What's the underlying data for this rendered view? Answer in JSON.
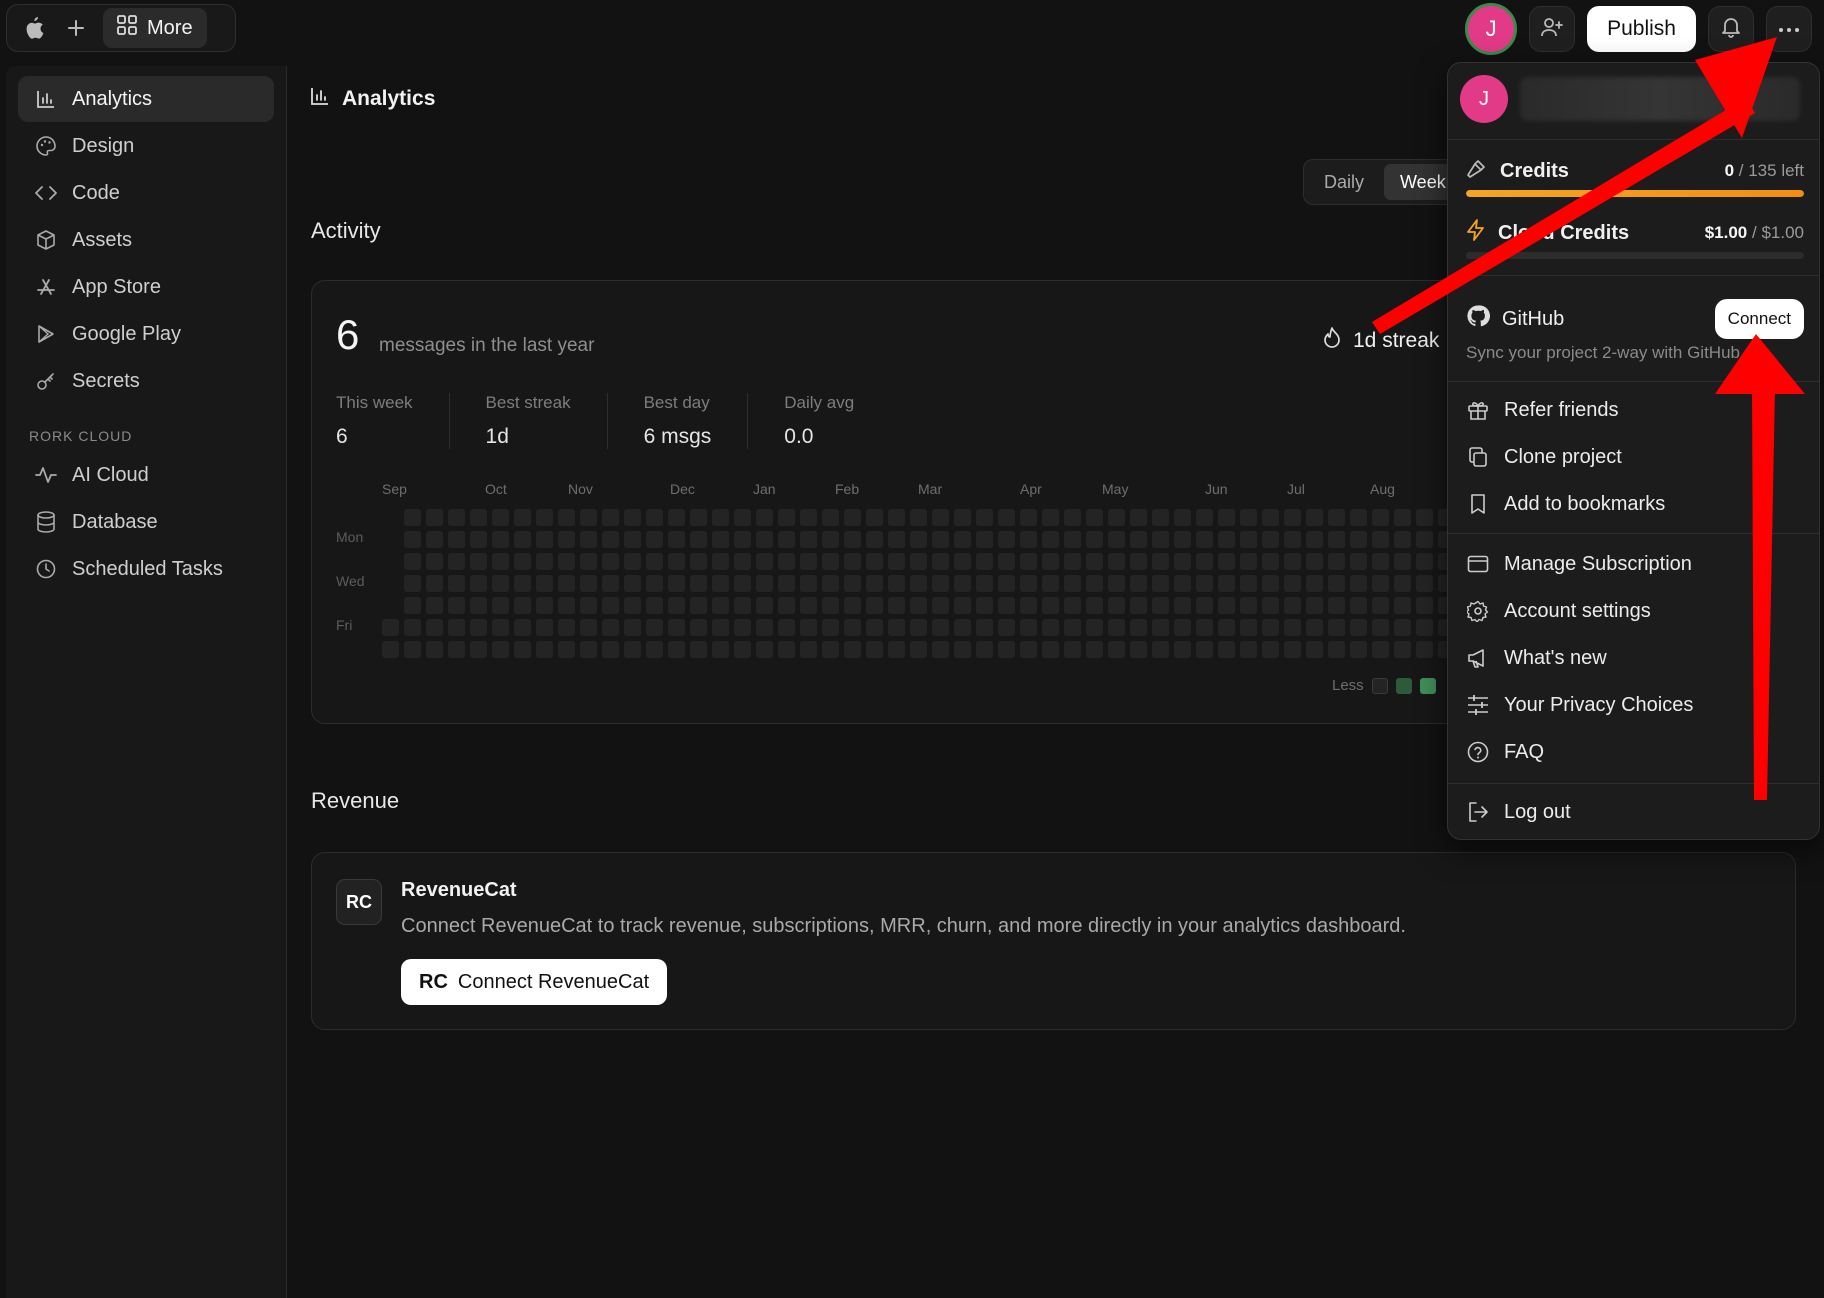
{
  "topbar": {
    "more_label": "More",
    "publish_label": "Publish",
    "avatar_initial": "J"
  },
  "sidebar": {
    "items": [
      {
        "label": "Analytics",
        "icon": "bar-chart-icon"
      },
      {
        "label": "Design",
        "icon": "palette-icon"
      },
      {
        "label": "Code",
        "icon": "code-icon"
      },
      {
        "label": "Assets",
        "icon": "box-icon"
      },
      {
        "label": "App Store",
        "icon": "app-store-icon"
      },
      {
        "label": "Google Play",
        "icon": "google-play-icon"
      },
      {
        "label": "Secrets",
        "icon": "key-icon"
      }
    ],
    "section_label": "RORK CLOUD",
    "cloud_items": [
      {
        "label": "AI Cloud",
        "icon": "activity-icon"
      },
      {
        "label": "Database",
        "icon": "database-icon"
      },
      {
        "label": "Scheduled Tasks",
        "icon": "clock-icon"
      }
    ]
  },
  "main": {
    "title": "Analytics",
    "toggle": {
      "daily": "Daily",
      "weekly": "Weekly"
    },
    "activity": {
      "heading": "Activity",
      "count": "6",
      "count_label": "messages in the last year",
      "streak": "1d streak",
      "stats": [
        {
          "label": "This week",
          "value": "6"
        },
        {
          "label": "Best streak",
          "value": "1d"
        },
        {
          "label": "Best day",
          "value": "6 msgs"
        },
        {
          "label": "Daily avg",
          "value": "0.0"
        }
      ],
      "months": [
        "Sep",
        "Oct",
        "Nov",
        "Dec",
        "Jan",
        "Feb",
        "Mar",
        "Apr",
        "May",
        "Jun",
        "Jul",
        "Aug"
      ],
      "days": [
        "Mon",
        "Wed",
        "Fri"
      ],
      "legend_less": "Less"
    },
    "revenue": {
      "heading": "Revenue",
      "name": "RevenueCat",
      "logo": "RC",
      "description": "Connect RevenueCat to track revenue, subscriptions, MRR, churn, and more directly in your analytics dashboard.",
      "button": "Connect RevenueCat"
    }
  },
  "dropdown": {
    "avatar_initial": "J",
    "credits": {
      "label": "Credits",
      "used": "0",
      "total": "/ 135 left",
      "fill": 1.0
    },
    "cloud_credits": {
      "label": "Cloud Credits",
      "used": "$1.00",
      "total": "/ $1.00",
      "fill": 0.0
    },
    "github": {
      "label": "GitHub",
      "button": "Connect",
      "subtitle": "Sync your project 2-way with GitHub"
    },
    "group1": [
      {
        "label": "Refer friends",
        "icon": "gift-icon"
      },
      {
        "label": "Clone project",
        "icon": "copy-icon"
      },
      {
        "label": "Add to bookmarks",
        "icon": "bookmark-icon"
      }
    ],
    "group2": [
      {
        "label": "Manage Subscription",
        "icon": "credit-card-icon"
      },
      {
        "label": "Account settings",
        "icon": "gear-icon"
      },
      {
        "label": "What's new",
        "icon": "megaphone-icon"
      },
      {
        "label": "Your Privacy Choices",
        "icon": "sliders-icon"
      },
      {
        "label": "FAQ",
        "icon": "help-circle-icon"
      }
    ],
    "logout": {
      "label": "Log out",
      "icon": "log-out-icon"
    }
  },
  "colors": {
    "accent_orange": "#f5a524",
    "annotation_red": "#ff0000",
    "avatar_pink": "#e23a87",
    "heatmap_low": "#2e5a3c",
    "heatmap_high": "#3f8f5a"
  }
}
